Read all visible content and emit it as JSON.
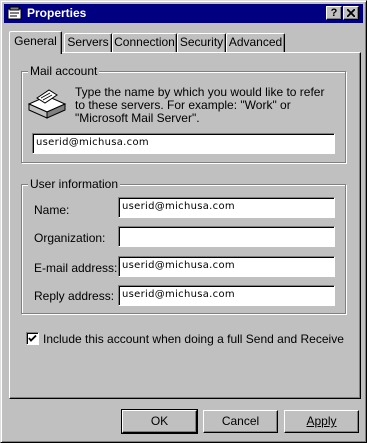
{
  "window": {
    "title": "Properties",
    "help_label": "?",
    "close_label": "✕"
  },
  "tabs": [
    {
      "label": "General",
      "active": true
    },
    {
      "label": "Servers",
      "active": false
    },
    {
      "label": "Connection",
      "active": false
    },
    {
      "label": "Security",
      "active": false
    },
    {
      "label": "Advanced",
      "active": false
    }
  ],
  "mail_account": {
    "group_label": "Mail account",
    "description": "Type the name by which you would like to refer to these servers.  For example: \"Work\" or \"Microsoft Mail Server\".",
    "account_name": "userid@michusa.com",
    "icon": "mail-account-icon"
  },
  "user_information": {
    "group_label": "User information",
    "name_label": "Name:",
    "name_value": "userid@michusa.com",
    "organization_label": "Organization:",
    "organization_value": "",
    "email_label": "E-mail address:",
    "email_value": "userid@michusa.com",
    "reply_label": "Reply address:",
    "reply_value": "userid@michusa.com"
  },
  "include_account": {
    "label": "Include this account when doing a full Send and Receive",
    "checked": true
  },
  "buttons": {
    "ok": "OK",
    "cancel": "Cancel",
    "apply": "Apply"
  },
  "colors": {
    "titlebar": "#000080",
    "face": "#c0c0c0"
  }
}
